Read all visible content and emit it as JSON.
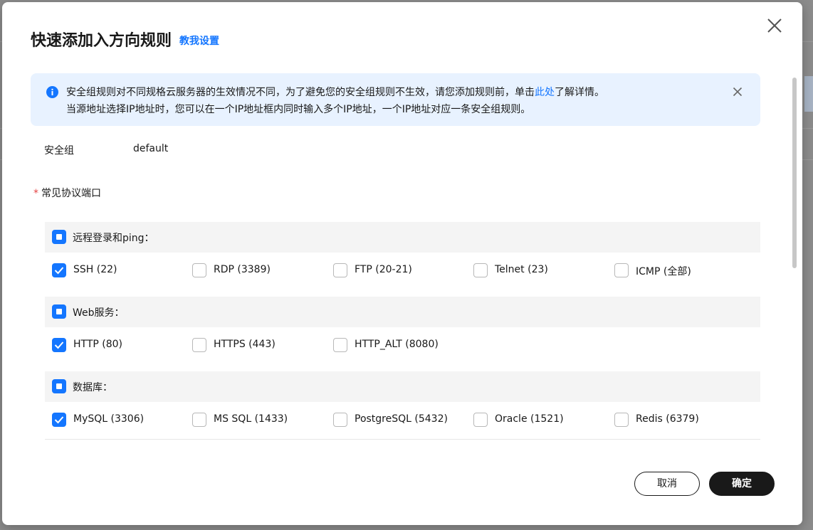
{
  "dialog": {
    "title": "快速添加入方向规则",
    "help_link": "教我设置"
  },
  "alert": {
    "line1_prefix": "安全组规则对不同规格云服务器的生效情况不同，为了避免您的安全组规则不生效，请您添加规则前，单击",
    "line1_link": "此处",
    "line1_suffix": "了解详情。",
    "line2": "当源地址选择IP地址时，您可以在一个IP地址框内同时输入多个IP地址，一个IP地址对应一条安全组规则。"
  },
  "security_group": {
    "label": "安全组",
    "value": "default"
  },
  "ports": {
    "required_mark": "*",
    "label": "常见协议端口",
    "groups": [
      {
        "label": "远程登录和ping：",
        "state": "partial",
        "options": [
          {
            "label": "SSH (22)",
            "checked": true
          },
          {
            "label": "RDP (3389)",
            "checked": false
          },
          {
            "label": "FTP (20-21)",
            "checked": false
          },
          {
            "label": "Telnet (23)",
            "checked": false
          },
          {
            "label": "ICMP (全部)",
            "checked": false
          }
        ]
      },
      {
        "label": "Web服务：",
        "state": "partial",
        "options": [
          {
            "label": "HTTP (80)",
            "checked": true
          },
          {
            "label": "HTTPS (443)",
            "checked": false
          },
          {
            "label": "HTTP_ALT (8080)",
            "checked": false
          }
        ]
      },
      {
        "label": "数据库：",
        "state": "partial",
        "options": [
          {
            "label": "MySQL (3306)",
            "checked": true
          },
          {
            "label": "MS SQL (1433)",
            "checked": false
          },
          {
            "label": "PostgreSQL (5432)",
            "checked": false
          },
          {
            "label": "Oracle (1521)",
            "checked": false
          },
          {
            "label": "Redis (6379)",
            "checked": false
          }
        ]
      }
    ]
  },
  "footer": {
    "cancel_label": "取消",
    "ok_label": "确定"
  },
  "colors": {
    "accent": "#1476ff",
    "alert_bg": "#e8f2ff",
    "primary_button": "#191919"
  }
}
